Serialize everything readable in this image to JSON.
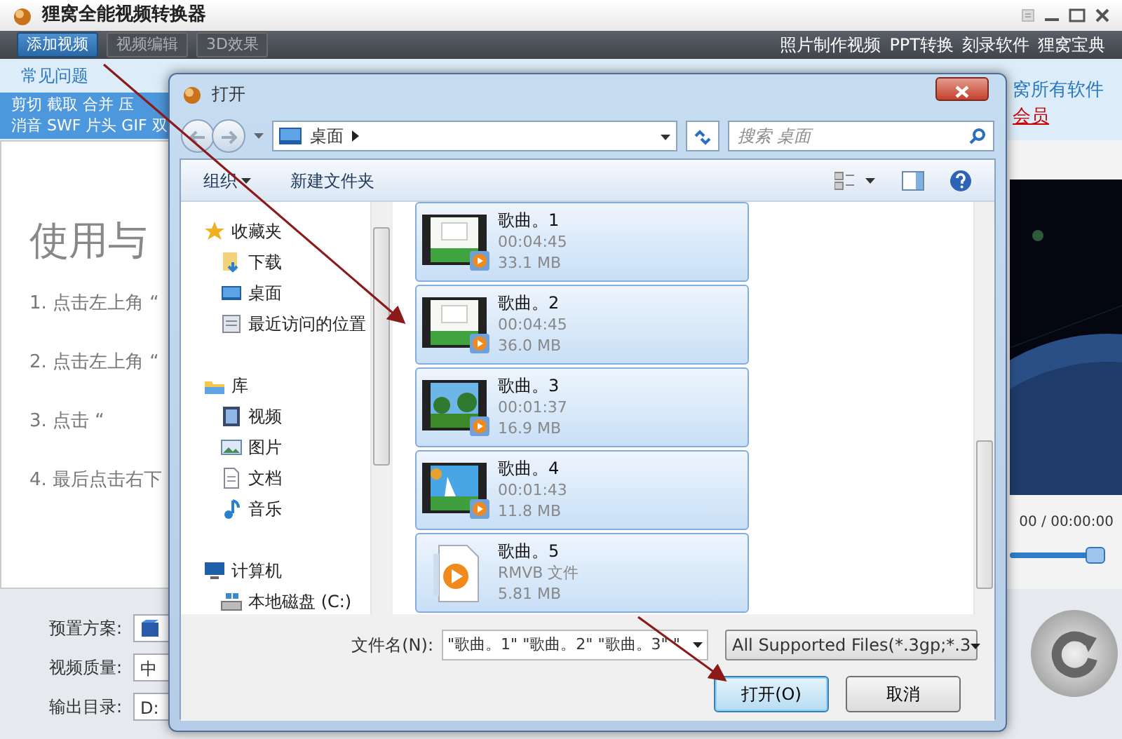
{
  "app": {
    "title": "狸窝全能视频转换器",
    "toolbar_buttons": [
      {
        "label": "添加视频",
        "selected": true,
        "disabled": false
      },
      {
        "label": "视频编辑",
        "selected": false,
        "disabled": true
      },
      {
        "label": "3D效果",
        "selected": false,
        "disabled": true
      }
    ],
    "links": [
      "照片制作视频",
      "PPT转换",
      "刻录软件",
      "狸窝宝典"
    ],
    "tab": "常见问题",
    "feature_rows": [
      "剪切 截取 合并 压",
      "消音 SWF 片头 GIF 双"
    ],
    "side_links": [
      {
        "text": "窝所有软件",
        "kind": "link"
      },
      {
        "text": "会员",
        "kind": "vip"
      }
    ],
    "guide": {
      "heading": "使用与",
      "steps": [
        "1. 点击左上角 “",
        "2. 点击左上角 “",
        "3. 点击 “",
        "4. 最后点击右下"
      ]
    },
    "player": {
      "time": "00 / 00:00:00",
      "level": 0.92
    },
    "settings": [
      {
        "label": "预置方案:"
      },
      {
        "label": "视频质量:",
        "value": "中"
      },
      {
        "label": "输出目录:",
        "value": "D:"
      }
    ]
  },
  "dialog": {
    "title": "打开",
    "address": "桌面",
    "search_placeholder": "搜索 桌面",
    "toolbar": [
      {
        "label": "组织",
        "dropdown": true
      },
      {
        "label": "新建文件夹",
        "dropdown": false
      }
    ],
    "nav": [
      {
        "label": "收藏夹",
        "kind": "star",
        "children": [
          {
            "label": "下载",
            "kind": "download"
          },
          {
            "label": "桌面",
            "kind": "desktop"
          },
          {
            "label": "最近访问的位置",
            "kind": "recent"
          }
        ]
      },
      {
        "label": "库",
        "kind": "library",
        "children": [
          {
            "label": "视频",
            "kind": "video"
          },
          {
            "label": "图片",
            "kind": "picture"
          },
          {
            "label": "文档",
            "kind": "doc"
          },
          {
            "label": "音乐",
            "kind": "music"
          }
        ]
      },
      {
        "label": "计算机",
        "kind": "computer",
        "children": [
          {
            "label": "本地磁盘 (C:)",
            "kind": "disk"
          }
        ]
      }
    ],
    "files": [
      {
        "name": "歌曲。1",
        "detail": "00:04:45",
        "size": "33.1 MB",
        "kind": "video",
        "selected": true
      },
      {
        "name": "歌曲。2",
        "detail": "00:04:45",
        "size": "36.0 MB",
        "kind": "video",
        "selected": true
      },
      {
        "name": "歌曲。3",
        "detail": "00:01:37",
        "size": "16.9 MB",
        "kind": "video",
        "selected": true
      },
      {
        "name": "歌曲。4",
        "detail": "00:01:43",
        "size": "11.8 MB",
        "kind": "video",
        "selected": true
      },
      {
        "name": "歌曲。5",
        "detail": "RMVB 文件",
        "size": "5.81 MB",
        "kind": "file",
        "selected": true
      }
    ],
    "filename_label": "文件名(N):",
    "filename_value": "\"歌曲。1\" \"歌曲。2\" \"歌曲。3\" \"",
    "filter": "All Supported Files(*.3gp;*.3",
    "buttons": [
      {
        "label": "打开(O)",
        "default": true
      },
      {
        "label": "取消",
        "default": false
      }
    ]
  }
}
